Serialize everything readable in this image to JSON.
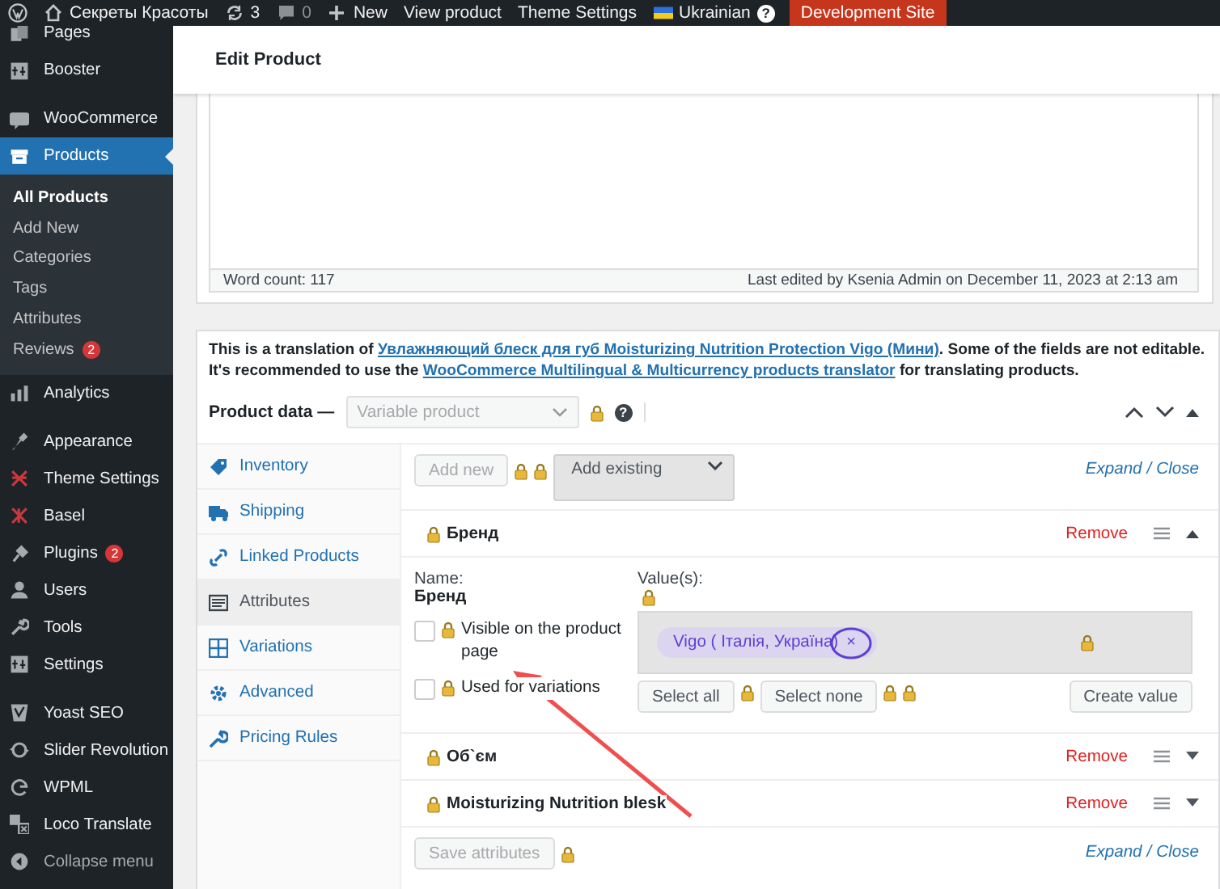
{
  "admin_bar": {
    "items": [
      {
        "kind": "wp-logo"
      },
      {
        "kind": "site",
        "label": "Секреты Красоты"
      },
      {
        "kind": "updates",
        "label": "3"
      },
      {
        "kind": "comments",
        "label": "0"
      },
      {
        "kind": "new",
        "label": "New"
      },
      {
        "kind": "link",
        "label": "View product"
      },
      {
        "kind": "link",
        "label": "Theme Settings"
      },
      {
        "kind": "language",
        "label": "Ukrainian",
        "help": "?"
      },
      {
        "kind": "environment",
        "label": "Development Site"
      }
    ]
  },
  "sidebar": {
    "groups": [
      [
        {
          "kind": "menu",
          "label": "Pages",
          "selected": false
        },
        {
          "kind": "menu",
          "label": "Booster",
          "selected": false
        }
      ],
      [
        {
          "kind": "menu",
          "label": "WooCommerce",
          "selected": false
        },
        {
          "kind": "menu",
          "label": "Products",
          "selected": true,
          "children": [
            {
              "label": "All Products",
              "selected": true
            },
            {
              "label": "Add New",
              "selected": false
            },
            {
              "label": "Categories",
              "selected": false
            },
            {
              "label": "Tags",
              "selected": false
            },
            {
              "label": "Attributes",
              "selected": false
            },
            {
              "label": "Reviews",
              "selected": false,
              "badge": "2"
            }
          ]
        },
        {
          "kind": "menu",
          "label": "Analytics",
          "selected": false
        }
      ],
      [
        {
          "kind": "menu",
          "label": "Appearance",
          "selected": false
        },
        {
          "kind": "menu",
          "label": "Theme Settings",
          "selected": false
        },
        {
          "kind": "menu",
          "label": "Basel",
          "selected": false
        },
        {
          "kind": "menu",
          "label": "Plugins",
          "selected": false,
          "badge": "2"
        },
        {
          "kind": "menu",
          "label": "Users",
          "selected": false
        },
        {
          "kind": "menu",
          "label": "Tools",
          "selected": false
        },
        {
          "kind": "menu",
          "label": "Settings",
          "selected": false
        }
      ],
      [
        {
          "kind": "menu",
          "label": "Yoast SEO",
          "selected": false
        },
        {
          "kind": "menu",
          "label": "Slider Revolution",
          "selected": false
        },
        {
          "kind": "menu",
          "label": "WPML",
          "selected": false
        },
        {
          "kind": "menu",
          "label": "Loco Translate",
          "selected": false
        },
        {
          "kind": "collapse",
          "label": "Collapse menu",
          "selected": false
        }
      ]
    ]
  },
  "page": {
    "title": "Edit Product"
  },
  "editor": {
    "word_count": "Word count: 117",
    "last_edited": "Last edited by Ksenia Admin on December 11, 2023 at 2:13 am"
  },
  "notice": {
    "lines": [
      {
        "before": "This is a translation of ",
        "link": "Увлажняющий блеск для губ Moisturizing Nutrition Protection Vigo (Мини)",
        "after": ". Some of the fields are not editable."
      },
      {
        "before": "It's recommended to use the ",
        "link": "WooCommerce Multilingual & Multicurrency products translator",
        "after": " for translating products."
      }
    ]
  },
  "product_data": {
    "label": "Product data —",
    "type_select": {
      "value": "Variable product",
      "disabled": true
    },
    "help": "?",
    "tabs": [
      {
        "label": "Inventory",
        "selected": false
      },
      {
        "label": "Shipping",
        "selected": false
      },
      {
        "label": "Linked Products",
        "selected": false
      },
      {
        "label": "Attributes",
        "selected": true
      },
      {
        "label": "Variations",
        "selected": false
      },
      {
        "label": "Advanced",
        "selected": false
      },
      {
        "label": "Pricing Rules",
        "selected": false
      }
    ],
    "toolbar": {
      "add_new": "Add new",
      "add_existing": "Add existing",
      "expand": "Expand",
      "separator": "/",
      "close": "Close"
    },
    "attributes": [
      {
        "name": "Бренд",
        "expanded": true,
        "remove": "Remove",
        "name_label": "Name:",
        "name_value": "Бренд",
        "options": [
          {
            "label": "Visible on the product page",
            "checked": false
          },
          {
            "label": "Used for variations",
            "checked": false
          }
        ],
        "values_label": "Value(s):",
        "values": [
          {
            "label": "Vigo ( Італія, Україна)",
            "remove": "×"
          }
        ],
        "buttons": [
          "Select all",
          "Select none",
          "Create value"
        ]
      },
      {
        "name": "Об`єм",
        "expanded": false,
        "remove": "Remove"
      },
      {
        "name": "Moisturizing Nutrition blesk",
        "expanded": false,
        "remove": "Remove"
      }
    ],
    "footer": {
      "save": "Save attributes",
      "expand": "Expand",
      "separator": "/",
      "close": "Close"
    }
  }
}
